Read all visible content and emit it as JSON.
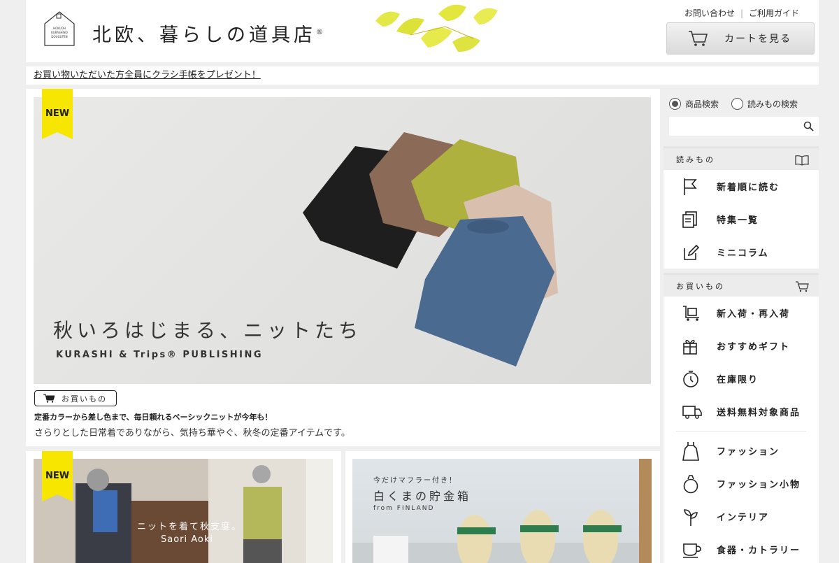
{
  "header": {
    "logo_mark_text": "HOKUOH KURASHINO DOUGUTEN",
    "logo_text": "北欧、暮らしの道具店",
    "logo_registered": "®",
    "contact_link": "お問い合わせ",
    "link_separator": "|",
    "guide_link": "ご利用ガイド",
    "cart_button": "カートを見る"
  },
  "promo": {
    "text": "お買い物いただいた方全員にクラシ手帳をプレゼント！"
  },
  "hero": {
    "badge": "NEW",
    "title": "秋いろはじまる、ニットたち",
    "subtitle": "KURASHI & Trips®  PUBLISHING",
    "shop_tag": "お買いもの",
    "lead": "定番カラーから差し色まで、毎日頼れるベーシックニットが今年も！",
    "description": "さらりとした日常着でありながら、気持ち華やぐ、秋冬の定番アイテムです。"
  },
  "card_left": {
    "badge": "NEW",
    "caption_line1": "ニットを着て秋支度。",
    "caption_line2": "Saori Aoki"
  },
  "card_right": {
    "kicker": "今だけマフラー付き！",
    "title": "白くまの貯金箱",
    "sub": "from FINLAND"
  },
  "search": {
    "option_products": "商品検索",
    "option_articles": "読みもの検索",
    "placeholder": ""
  },
  "sidebar": {
    "reading_title": "読みもの",
    "reading_items": [
      {
        "label": "新着順に読む",
        "icon": "flag-icon"
      },
      {
        "label": "特集一覧",
        "icon": "document-stack-icon"
      },
      {
        "label": "ミニコラム",
        "icon": "edit-note-icon"
      }
    ],
    "shopping_title": "お買いもの",
    "shopping_items": [
      {
        "label": "新入荷・再入荷",
        "icon": "cart-box-icon"
      },
      {
        "label": "おすすめギフト",
        "icon": "gift-icon"
      },
      {
        "label": "在庫限り",
        "icon": "timer-icon"
      },
      {
        "label": "送料無料対象商品",
        "icon": "truck-icon"
      }
    ],
    "category_items": [
      {
        "label": "ファッション",
        "icon": "dress-icon"
      },
      {
        "label": "ファッション小物",
        "icon": "ring-icon"
      },
      {
        "label": "インテリア",
        "icon": "plant-icon"
      },
      {
        "label": "食器・カトラリー",
        "icon": "cup-icon"
      }
    ]
  },
  "colors": {
    "badge_yellow": "#f6e600",
    "background": "#efefef",
    "panel_head": "#ececec"
  }
}
